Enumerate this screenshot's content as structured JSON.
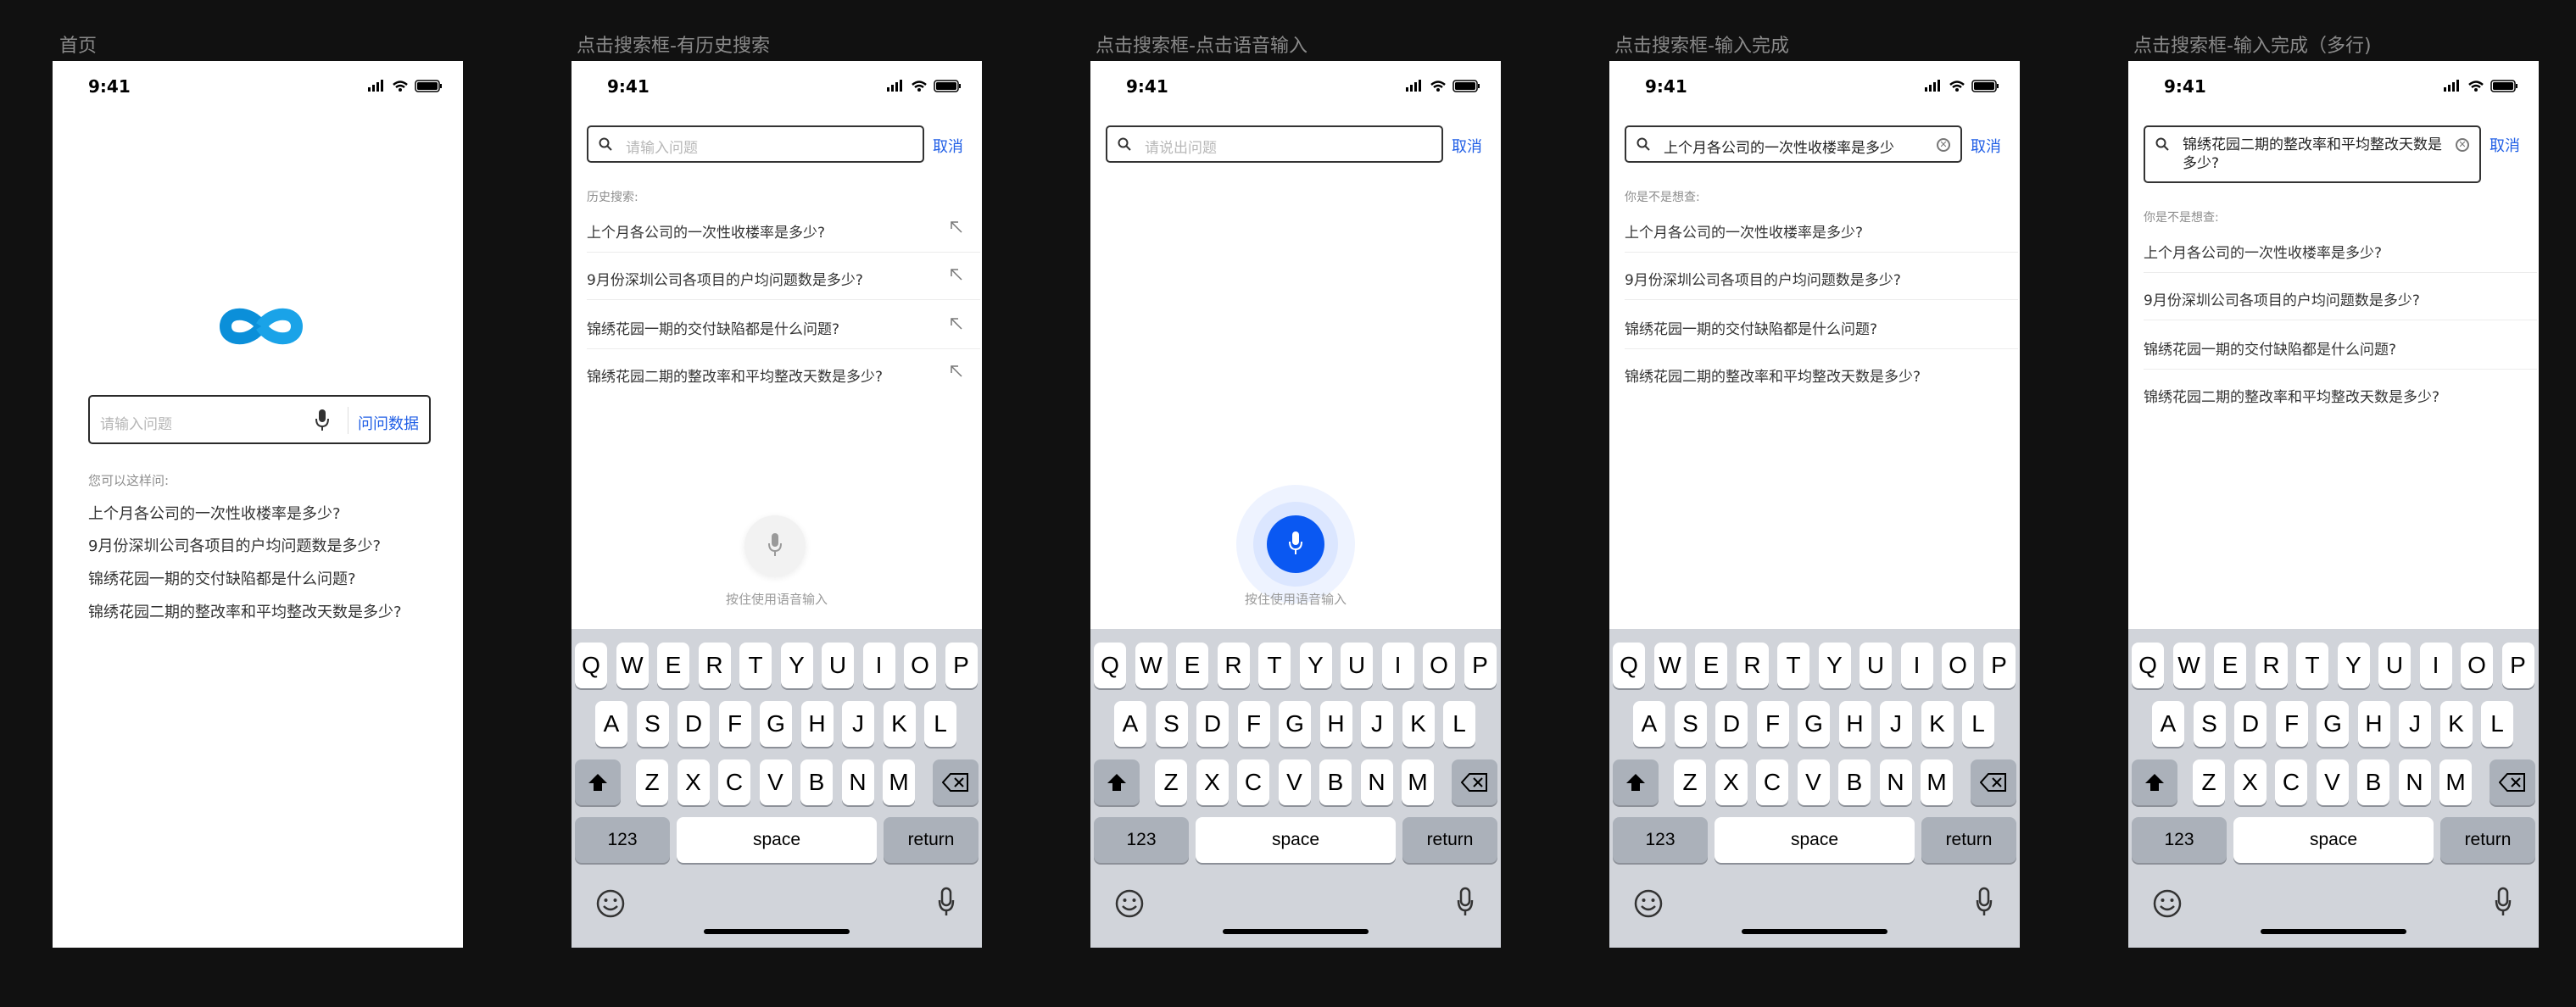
{
  "status": {
    "time": "9:41"
  },
  "frames": [
    {
      "title": "首页"
    },
    {
      "title": "点击搜索框-有历史搜索"
    },
    {
      "title": "点击搜索框-点击语音输入"
    },
    {
      "title": "点击搜索框-输入完成"
    },
    {
      "title": "点击搜索框-输入完成（多行)"
    }
  ],
  "home": {
    "search_placeholder": "请输入问题",
    "ask_button": "问问数据",
    "hint": "您可以这样问:",
    "questions": [
      "上个月各公司的一次性收楼率是多少?",
      "9月份深圳公司各项目的户均问题数是多少?",
      "锦绣花园一期的交付缺陷都是什么问题?",
      "锦绣花园二期的整改率和平均整改天数是多少?"
    ]
  },
  "history": {
    "search_placeholder": "请输入问题",
    "cancel": "取消",
    "label": "历史搜索:",
    "items": [
      "上个月各公司的一次性收楼率是多少?",
      "9月份深圳公司各项目的户均问题数是多少?",
      "锦绣花园一期的交付缺陷都是什么问题?",
      "锦绣花园二期的整改率和平均整改天数是多少?"
    ],
    "voice_hint": "按住使用语音输入"
  },
  "voice": {
    "search_placeholder": "请说出问题",
    "cancel": "取消",
    "voice_hint": "按住使用语音输入"
  },
  "done": {
    "search_value": "上个月各公司的一次性收楼率是多少",
    "cancel": "取消",
    "label": "你是不是想查:",
    "items": [
      "上个月各公司的一次性收楼率是多少?",
      "9月份深圳公司各项目的户均问题数是多少?",
      "锦绣花园一期的交付缺陷都是什么问题?",
      "锦绣花园二期的整改率和平均整改天数是多少?"
    ]
  },
  "multi": {
    "search_value": "锦绣花园二期的整改率和平均整改天数是多少?",
    "cancel": "取消",
    "label": "你是不是想查:",
    "items": [
      "上个月各公司的一次性收楼率是多少?",
      "9月份深圳公司各项目的户均问题数是多少?",
      "锦绣花园一期的交付缺陷都是什么问题?",
      "锦绣花园二期的整改率和平均整改天数是多少?"
    ]
  },
  "keyboard": {
    "row1": [
      "Q",
      "W",
      "E",
      "R",
      "T",
      "Y",
      "U",
      "I",
      "O",
      "P"
    ],
    "row2": [
      "A",
      "S",
      "D",
      "F",
      "G",
      "H",
      "J",
      "K",
      "L"
    ],
    "row3": [
      "Z",
      "X",
      "C",
      "V",
      "B",
      "N",
      "M"
    ],
    "numbers": "123",
    "space": "space",
    "return": "return"
  },
  "colors": {
    "accent": "#1f5ee6",
    "voice_button": "#0a58f2",
    "background": "#111111",
    "keyboard": "#d1d4da"
  }
}
